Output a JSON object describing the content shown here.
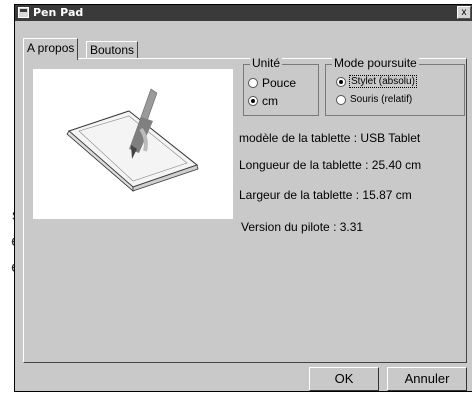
{
  "background": {
    "side_letters": [
      "s",
      "e",
      "e"
    ]
  },
  "window": {
    "title": "Pen Pad",
    "close_glyph": "x"
  },
  "tabs": [
    {
      "label": "A propos",
      "active": true
    },
    {
      "label": "Boutons",
      "active": false
    }
  ],
  "unit_group": {
    "title": "Unité",
    "options": [
      {
        "label": "Pouce",
        "selected": false
      },
      {
        "label": "cm",
        "selected": true
      }
    ]
  },
  "mode_group": {
    "title": "Mode poursuite",
    "options": [
      {
        "label": "Stylet (absolu)",
        "selected": true
      },
      {
        "label": "Souris (relatif)",
        "selected": false
      }
    ]
  },
  "info": {
    "model": "modèle de la tablette : USB Tablet",
    "length": "Longueur de la tablette : 25.40 cm",
    "width": "Largeur de la tablette : 15.87 cm",
    "driver_version": "Version du pilote : 3.31"
  },
  "buttons": {
    "ok": "OK",
    "cancel": "Annuler"
  }
}
